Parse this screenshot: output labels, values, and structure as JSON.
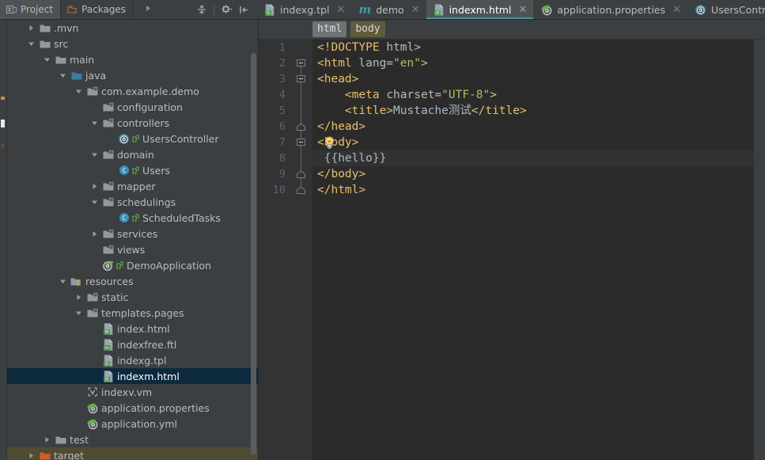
{
  "window": {
    "theme_bg": "#3c3f41",
    "editor_bg": "#2b2b2b",
    "accent": "#4a90a4",
    "selection_bg": "#0d293e",
    "excluded_bg": "#4f4b34"
  },
  "project_toolbar": {
    "tabs": [
      {
        "label": "Project",
        "icon": "project-icon",
        "selected": true
      },
      {
        "label": "Packages",
        "icon": "packages-icon",
        "selected": false
      }
    ],
    "overflow_label": "▶",
    "actions": [
      {
        "name": "collapse-all-icon",
        "title": "Collapse All"
      },
      {
        "name": "settings-gear-icon",
        "title": "Settings"
      },
      {
        "name": "hide-panel-icon",
        "title": "Hide"
      }
    ]
  },
  "editor_tabs": [
    {
      "label": "indexg.tpl",
      "icon": "tpl-file-icon",
      "badge": "G",
      "active": false,
      "closable": true
    },
    {
      "label": "demo",
      "icon": "maven-icon",
      "badge": "m",
      "active": false,
      "closable": true
    },
    {
      "label": "indexm.html",
      "icon": "html-file-icon",
      "badge": "H",
      "active": true,
      "closable": true
    },
    {
      "label": "application.properties",
      "icon": "spring-properties-icon",
      "badge": "",
      "active": false,
      "closable": true
    },
    {
      "label": "UsersController.java",
      "icon": "spring-controller-icon",
      "badge": "",
      "active": false,
      "closable": true
    }
  ],
  "breadcrumbs": [
    {
      "label": "html",
      "style": "gray"
    },
    {
      "label": "body",
      "style": "olive"
    }
  ],
  "tree": [
    {
      "label": ".mvn",
      "indent": 1,
      "arrow": "collapsed",
      "icon": "folder-gray",
      "state": "normal"
    },
    {
      "label": "src",
      "indent": 1,
      "arrow": "expanded",
      "icon": "folder-gray",
      "state": "normal"
    },
    {
      "label": "main",
      "indent": 2,
      "arrow": "expanded",
      "icon": "folder-gray",
      "state": "normal"
    },
    {
      "label": "java",
      "indent": 3,
      "arrow": "expanded",
      "icon": "folder-source",
      "state": "normal"
    },
    {
      "label": "com.example.demo",
      "indent": 4,
      "arrow": "expanded",
      "icon": "package-icon",
      "state": "normal"
    },
    {
      "label": "configuration",
      "indent": 5,
      "arrow": "none",
      "icon": "package-icon",
      "state": "normal"
    },
    {
      "label": "controllers",
      "indent": 5,
      "arrow": "expanded",
      "icon": "package-icon",
      "state": "normal"
    },
    {
      "label": "UsersController",
      "indent": 6,
      "arrow": "none",
      "icon": "spring-controller-icon",
      "state": "normal"
    },
    {
      "label": "domain",
      "indent": 5,
      "arrow": "expanded",
      "icon": "package-icon",
      "state": "normal"
    },
    {
      "label": "Users",
      "indent": 6,
      "arrow": "none",
      "icon": "class-icon",
      "state": "normal"
    },
    {
      "label": "mapper",
      "indent": 5,
      "arrow": "collapsed",
      "icon": "package-icon",
      "state": "normal"
    },
    {
      "label": "schedulings",
      "indent": 5,
      "arrow": "expanded",
      "icon": "package-icon",
      "state": "normal"
    },
    {
      "label": "ScheduledTasks",
      "indent": 6,
      "arrow": "none",
      "icon": "class-icon",
      "state": "normal"
    },
    {
      "label": "services",
      "indent": 5,
      "arrow": "collapsed",
      "icon": "package-icon",
      "state": "normal"
    },
    {
      "label": "views",
      "indent": 5,
      "arrow": "none",
      "icon": "package-icon",
      "state": "normal"
    },
    {
      "label": "DemoApplication",
      "indent": 5,
      "arrow": "none",
      "icon": "spring-boot-icon",
      "state": "normal"
    },
    {
      "label": "resources",
      "indent": 3,
      "arrow": "expanded",
      "icon": "folder-resources",
      "state": "normal"
    },
    {
      "label": "static",
      "indent": 4,
      "arrow": "collapsed",
      "icon": "package-icon",
      "state": "normal"
    },
    {
      "label": "templates.pages",
      "indent": 4,
      "arrow": "expanded",
      "icon": "package-icon",
      "state": "normal"
    },
    {
      "label": "index.html",
      "indent": 5,
      "arrow": "none",
      "icon": "html-file-icon",
      "state": "normal"
    },
    {
      "label": "indexfree.ftl",
      "indent": 5,
      "arrow": "none",
      "icon": "ftl-file-icon",
      "state": "normal"
    },
    {
      "label": "indexg.tpl",
      "indent": 5,
      "arrow": "none",
      "icon": "tpl-file-icon",
      "state": "normal"
    },
    {
      "label": "indexm.html",
      "indent": 5,
      "arrow": "none",
      "icon": "html-file-icon",
      "state": "selected"
    },
    {
      "label": "indexv.vm",
      "indent": 4,
      "arrow": "none",
      "icon": "vm-file-icon",
      "state": "normal"
    },
    {
      "label": "application.properties",
      "indent": 4,
      "arrow": "none",
      "icon": "spring-properties-icon",
      "state": "normal"
    },
    {
      "label": "application.yml",
      "indent": 4,
      "arrow": "none",
      "icon": "spring-properties-icon",
      "state": "normal"
    },
    {
      "label": "test",
      "indent": 2,
      "arrow": "collapsed",
      "icon": "folder-gray",
      "state": "normal"
    },
    {
      "label": "target",
      "indent": 1,
      "arrow": "collapsed",
      "icon": "folder-orange",
      "state": "excluded"
    }
  ],
  "code": {
    "lines": [
      {
        "n": "1",
        "fold": "none",
        "current": false,
        "tokens": [
          {
            "t": "<!DOCTYPE ",
            "c": "tg"
          },
          {
            "t": "html>",
            "c": "atn"
          }
        ]
      },
      {
        "n": "2",
        "fold": "open",
        "current": false,
        "tokens": [
          {
            "t": "<html ",
            "c": "tg"
          },
          {
            "t": "lang=",
            "c": "atn"
          },
          {
            "t": "\"en\"",
            "c": "ats"
          },
          {
            "t": ">",
            "c": "tg"
          }
        ]
      },
      {
        "n": "3",
        "fold": "open",
        "current": false,
        "tokens": [
          {
            "t": "<head>",
            "c": "tg"
          }
        ]
      },
      {
        "n": "4",
        "fold": "none",
        "current": false,
        "tokens": [
          {
            "t": "    <meta ",
            "c": "tg"
          },
          {
            "t": "charset=",
            "c": "atn"
          },
          {
            "t": "\"UTF-8\"",
            "c": "ats"
          },
          {
            "t": ">",
            "c": "tg"
          }
        ]
      },
      {
        "n": "5",
        "fold": "none",
        "current": false,
        "tokens": [
          {
            "t": "    <title>",
            "c": "tg"
          },
          {
            "t": "Mustache测试",
            "c": "txtc"
          },
          {
            "t": "</title>",
            "c": "tg"
          }
        ]
      },
      {
        "n": "6",
        "fold": "close",
        "current": false,
        "tokens": [
          {
            "t": "</head>",
            "c": "tg"
          }
        ]
      },
      {
        "n": "7",
        "fold": "open",
        "current": false,
        "bulb": true,
        "tokens": [
          {
            "t": "<body>",
            "c": "tg"
          }
        ]
      },
      {
        "n": "8",
        "fold": "none",
        "current": true,
        "tokens": [
          {
            "t": " {{hello}}",
            "c": "moust"
          }
        ]
      },
      {
        "n": "9",
        "fold": "close",
        "current": false,
        "tokens": [
          {
            "t": "</body>",
            "c": "tg"
          }
        ]
      },
      {
        "n": "10",
        "fold": "close",
        "current": false,
        "tokens": [
          {
            "t": "</html>",
            "c": "tg"
          }
        ]
      }
    ]
  }
}
